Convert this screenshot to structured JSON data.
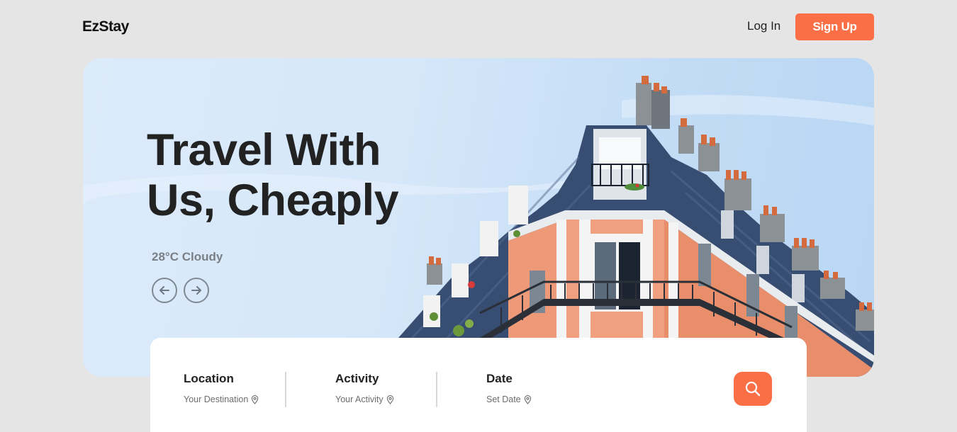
{
  "brand": {
    "logo_text": "EzStay"
  },
  "nav": {
    "login_label": "Log In",
    "signup_label": "Sign Up"
  },
  "hero": {
    "headline_line1": "Travel With",
    "headline_line2": "Us, Cheaply",
    "weather": "28°C Cloudy",
    "prev_icon": "arrow-left-icon",
    "next_icon": "arrow-right-icon"
  },
  "search": {
    "fields": [
      {
        "title": "Location",
        "value": "Your Destination",
        "icon": "location-pin-icon"
      },
      {
        "title": "Activity",
        "value": "Your Activity",
        "icon": "location-pin-icon"
      },
      {
        "title": "Date",
        "value": "Set Date",
        "icon": "location-pin-icon"
      }
    ],
    "button_icon": "search-icon"
  },
  "colors": {
    "accent": "#fb6f47",
    "background": "#e5e5e5",
    "text_dark": "#222222",
    "weather_text": "#7a7f86"
  }
}
